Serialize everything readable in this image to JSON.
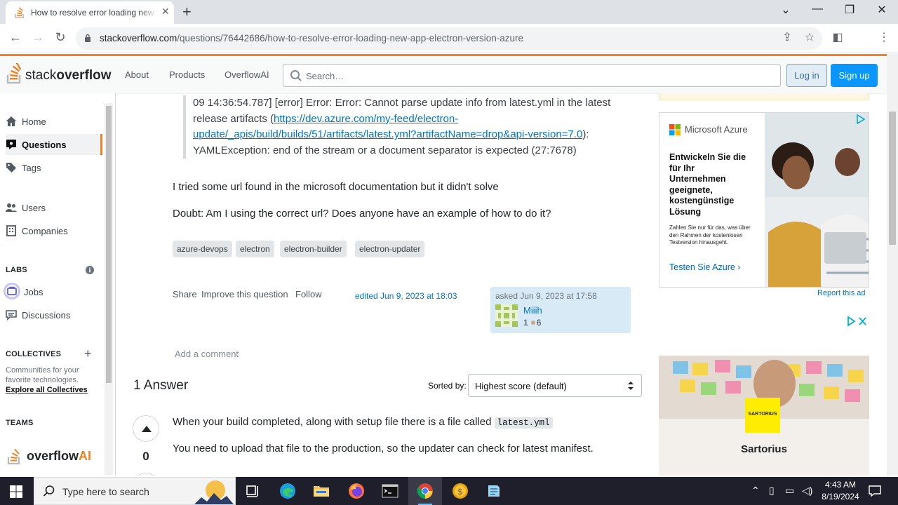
{
  "browser": {
    "tab_title": "How to resolve error loading new app electron version azure",
    "url_domain": "stackoverflow.com",
    "url_path": "/questions/76442686/how-to-resolve-error-loading-new-app-electron-version-azure"
  },
  "header": {
    "logo_prefix": "stack",
    "logo_suffix": "overflow",
    "nav": [
      "About",
      "Products",
      "OverflowAI"
    ],
    "search_placeholder": "Search…",
    "login": "Log in",
    "signup": "Sign up"
  },
  "sidebar": {
    "items": [
      {
        "label": "Home",
        "icon": "home-icon"
      },
      {
        "label": "Questions",
        "icon": "questions-icon",
        "active": true
      },
      {
        "label": "Tags",
        "icon": "tag-icon"
      },
      {
        "label": "Users",
        "icon": "users-icon"
      },
      {
        "label": "Companies",
        "icon": "companies-icon"
      }
    ],
    "labs": "LABS",
    "labs_items": [
      {
        "label": "Jobs",
        "icon": "jobs-icon"
      },
      {
        "label": "Discussions",
        "icon": "discussions-icon"
      }
    ],
    "collectives": "COLLECTIVES",
    "collectives_desc": "Communities for your favorite technologies.",
    "explore": "Explore all Collectives",
    "teams": "TEAMS",
    "overflow_ai_prefix": "overflow",
    "overflow_ai_suffix": "AI"
  },
  "question": {
    "quote_line1": "09 14:36:54.787] [error] Error: Error: Cannot parse update info from latest.yml in the latest",
    "quote_line2": "release artifacts (",
    "quote_link1": "https://dev.azure.com/my-feed/electron-",
    "quote_link2": "update/_apis/build/builds/51/artifacts/latest.yml?artifactName=drop&api-version=7.0",
    "quote_line3_tail": "):",
    "quote_line4": "YAMLException: end of the stream or a document separator is expected (27:7678)",
    "para1": "I tried some url found in the microsoft documentation but it didn't solve",
    "para2": "Doubt: Am I using the correct url? Does anyone have an example of how to do it?",
    "tags": [
      "azure-devops",
      "electron",
      "electron-builder",
      "electron-updater"
    ],
    "menu": [
      "Share",
      "Improve this question",
      "Follow"
    ],
    "edited": "edited Jun 9, 2023 at 18:03",
    "asked": "asked Jun 9, 2023 at 17:58",
    "user_name": "Miiih",
    "user_rep": "1",
    "user_bronze": "6",
    "add_comment": "Add a comment"
  },
  "answers": {
    "heading": "1 Answer",
    "sorted_by": "Sorted by:",
    "sort_value": "Highest score (default)",
    "vote_count": "0",
    "text1_pre": "When your build completed, along with setup file there is a file called ",
    "text1_code": "latest.yml",
    "text2": "You need to upload that file to the production, so the updater can check for latest manifest."
  },
  "ads": {
    "azure_brand": "Microsoft Azure",
    "azure_head": "Entwickeln Sie die für Ihr Unternehmen geeignete, kostengünstige Lösung",
    "azure_small": "Zahlen Sie nur für das, was über den Rahmen der kostenlosen Testversion hinausgeht.",
    "azure_cta": "Testen Sie Azure ›",
    "report": "Report this ad",
    "sart_logo": "SARTORIUS",
    "sart_name": "Sartorius"
  },
  "taskbar": {
    "search_text": "Type here to search",
    "time": "4:43 AM",
    "date": "8/19/2024"
  },
  "colors": {
    "so_orange": "#f48024",
    "so_blue": "#0a95ff",
    "link": "#0074cc",
    "tag_bg": "#e3e6e8"
  }
}
